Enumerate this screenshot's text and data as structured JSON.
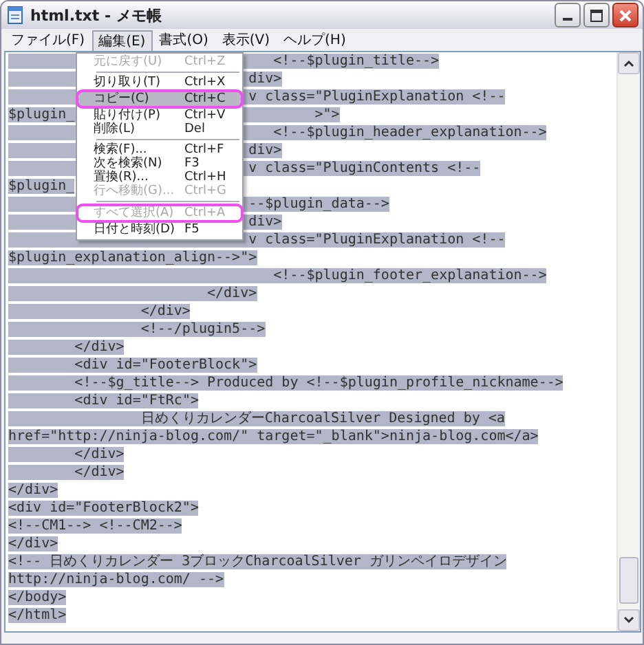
{
  "window": {
    "title": "html.txt - メモ帳"
  },
  "menu_bar": [
    {
      "label": "ファイル(F)",
      "selected": false
    },
    {
      "label": "編集(E)",
      "selected": true
    },
    {
      "label": "書式(O)",
      "selected": false
    },
    {
      "label": "表示(V)",
      "selected": false
    },
    {
      "label": "ヘルプ(H)",
      "selected": false
    }
  ],
  "edit_menu": {
    "items": [
      {
        "kind": "item",
        "label": "元に戻す(U)",
        "shortcut": "Ctrl+Z",
        "disabled": true,
        "selected": false,
        "circled": false
      },
      {
        "kind": "separator"
      },
      {
        "kind": "item",
        "label": "切り取り(T)",
        "shortcut": "Ctrl+X",
        "disabled": false,
        "selected": false,
        "circled": false
      },
      {
        "kind": "item",
        "label": "コピー(C)",
        "shortcut": "Ctrl+C",
        "disabled": false,
        "selected": true,
        "circled": true
      },
      {
        "kind": "item",
        "label": "貼り付け(P)",
        "shortcut": "Ctrl+V",
        "disabled": false,
        "selected": false,
        "circled": false
      },
      {
        "kind": "item",
        "label": "削除(L)",
        "shortcut": "Del",
        "disabled": false,
        "selected": false,
        "circled": false
      },
      {
        "kind": "separator"
      },
      {
        "kind": "item",
        "label": "検索(F)...",
        "shortcut": "Ctrl+F",
        "disabled": false,
        "selected": false,
        "circled": false
      },
      {
        "kind": "item",
        "label": "次を検索(N)",
        "shortcut": "F3",
        "disabled": false,
        "selected": false,
        "circled": false
      },
      {
        "kind": "item",
        "label": "置換(R)...",
        "shortcut": "Ctrl+H",
        "disabled": false,
        "selected": false,
        "circled": false
      },
      {
        "kind": "item",
        "label": "行へ移動(G)...",
        "shortcut": "Ctrl+G",
        "disabled": true,
        "selected": false,
        "circled": false
      },
      {
        "kind": "separator"
      },
      {
        "kind": "item",
        "label": "すべて選択(A)",
        "shortcut": "Ctrl+A",
        "disabled": true,
        "selected": false,
        "circled": true
      },
      {
        "kind": "item",
        "label": "日付と時刻(D)",
        "shortcut": "F5",
        "disabled": false,
        "selected": false,
        "circled": false
      }
    ]
  },
  "editor": {
    "selected": true,
    "lines": [
      "\t\t\t\t<!--$plugin_title-->",
      "\t\t\t     div>",
      "\t\t\t     v class=\"PluginExplanation <!--",
      "$plugin_\t\t\t     >\">",
      "\t\t\t\t<!--$plugin_header_explanation-->",
      "\t\t\t     div>",
      "\t\t\t     v class=\"PluginContents <!--",
      "$plugin_",
      "\t\t\t     --$plugin_data-->",
      "\t\t\t     div>",
      "\t\t\t     v class=\"PluginExplanation <!--",
      "$plugin_explanation_align-->\">",
      "\t\t\t\t<!--$plugin_footer_explanation-->",
      "\t\t\t</div>",
      "\t\t</div>",
      "\t\t<!--/plugin5-->",
      "\t</div>",
      "\t<div id=\"FooterBlock\">",
      "\t<!--$g_title--> Produced by <!--$plugin_profile_nickname-->",
      "\t<div id=\"FtRc\">",
      "\t\t日めくりカレンダーCharcoalSilver Designed by <a",
      "href=\"http://ninja-blog.com/\" target=\"_blank\">ninja-blog.com</a>",
      "\t</div>",
      "\t</div>",
      "</div>",
      "<div id=\"FooterBlock2\">",
      "<!--CM1--> <!--CM2-->",
      "</div>",
      "<!-- 日めくりカレンダー 3ブロックCharcoalSilver ガリンペイロデザイン",
      "http://ninja-blog.com/ -->",
      "</body>",
      "</html>"
    ]
  }
}
